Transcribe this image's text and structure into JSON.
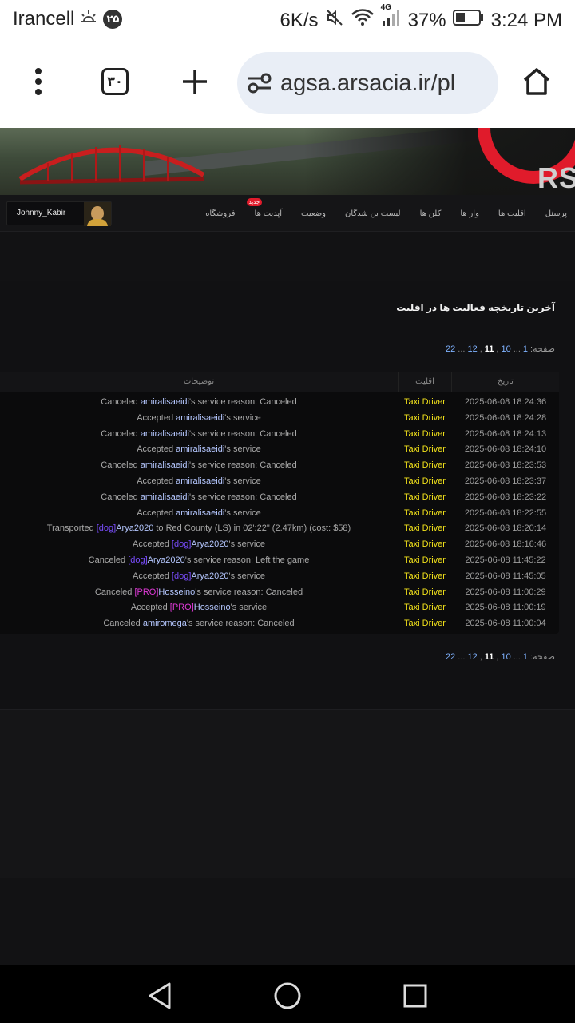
{
  "status_bar": {
    "carrier": "Irancell",
    "carrier_badge": "۲۵",
    "net_speed": "6K/s",
    "network_type": "4G",
    "battery": "37%",
    "time": "3:24 PM",
    "icons": [
      "sunset-icon",
      "mute-icon",
      "wifi-icon",
      "signal-icon",
      "battery-icon"
    ]
  },
  "browser": {
    "tab_count": "۳۰",
    "url": "agsa.arsacia.ir/pl",
    "icons": [
      "menu-dots-icon",
      "new-tab-icon",
      "site-settings-icon",
      "home-icon"
    ]
  },
  "site": {
    "logo_text": "RS",
    "nav_items": [
      {
        "label": "پرسنل"
      },
      {
        "label": "اقلیت ها"
      },
      {
        "label": "وار ها"
      },
      {
        "label": "کلن ها"
      },
      {
        "label": "لیست بن شدگان"
      },
      {
        "label": "وضعیت"
      },
      {
        "label": "آپدیت ها",
        "badge": "جدید"
      },
      {
        "label": "فروشگاه"
      }
    ],
    "user": {
      "name": "Johnny_Kabir"
    }
  },
  "history": {
    "heading": "آخرین تاریخچه فعالیت ها در اقلیت",
    "pagination": {
      "label": "صفحه:",
      "first": "1",
      "ellipsis": "...",
      "pages": [
        "10",
        "11",
        "12"
      ],
      "current": "11",
      "last": "22"
    },
    "columns": {
      "date": "تاریخ",
      "faction": "اقلیت",
      "description": "توضیحات"
    },
    "faction_color": "#f2e21b",
    "rows": [
      {
        "date": "2025-06-08 18:24:36",
        "faction": "Taxi Driver",
        "pre": "Canceled ",
        "tag": "",
        "name": "amiralisaeidi",
        "post": "'s service reason: Canceled"
      },
      {
        "date": "2025-06-08 18:24:28",
        "faction": "Taxi Driver",
        "pre": "Accepted ",
        "tag": "",
        "name": "amiralisaeidi",
        "post": "'s service"
      },
      {
        "date": "2025-06-08 18:24:13",
        "faction": "Taxi Driver",
        "pre": "Canceled ",
        "tag": "",
        "name": "amiralisaeidi",
        "post": "'s service reason: Canceled"
      },
      {
        "date": "2025-06-08 18:24:10",
        "faction": "Taxi Driver",
        "pre": "Accepted ",
        "tag": "",
        "name": "amiralisaeidi",
        "post": "'s service"
      },
      {
        "date": "2025-06-08 18:23:53",
        "faction": "Taxi Driver",
        "pre": "Canceled ",
        "tag": "",
        "name": "amiralisaeidi",
        "post": "'s service reason: Canceled"
      },
      {
        "date": "2025-06-08 18:23:37",
        "faction": "Taxi Driver",
        "pre": "Accepted ",
        "tag": "",
        "name": "amiralisaeidi",
        "post": "'s service"
      },
      {
        "date": "2025-06-08 18:23:22",
        "faction": "Taxi Driver",
        "pre": "Canceled ",
        "tag": "",
        "name": "amiralisaeidi",
        "post": "'s service reason: Canceled"
      },
      {
        "date": "2025-06-08 18:22:55",
        "faction": "Taxi Driver",
        "pre": "Accepted ",
        "tag": "",
        "name": "amiralisaeidi",
        "post": "'s service"
      },
      {
        "date": "2025-06-08 18:20:14",
        "faction": "Taxi Driver",
        "pre": "Transported ",
        "tag": "[dog]",
        "name": "Arya2020",
        "post": " to Red County (LS) in 02':22\" (2.47km) (cost: $58)"
      },
      {
        "date": "2025-06-08 18:16:46",
        "faction": "Taxi Driver",
        "pre": "Accepted ",
        "tag": "[dog]",
        "name": "Arya2020",
        "post": "'s service"
      },
      {
        "date": "2025-06-08 11:45:22",
        "faction": "Taxi Driver",
        "pre": "Canceled ",
        "tag": "[dog]",
        "name": "Arya2020",
        "post": "'s service reason: Left the game"
      },
      {
        "date": "2025-06-08 11:45:05",
        "faction": "Taxi Driver",
        "pre": "Accepted ",
        "tag": "[dog]",
        "name": "Arya2020",
        "post": "'s service"
      },
      {
        "date": "2025-06-08 11:00:29",
        "faction": "Taxi Driver",
        "pre": "Canceled ",
        "tag": "[PRO]",
        "name": "Hosseino",
        "post": "'s service reason: Canceled"
      },
      {
        "date": "2025-06-08 11:00:19",
        "faction": "Taxi Driver",
        "pre": "Accepted ",
        "tag": "[PRO]",
        "name": "Hosseino",
        "post": "'s service"
      },
      {
        "date": "2025-06-08 11:00:04",
        "faction": "Taxi Driver",
        "pre": "Canceled ",
        "tag": "",
        "name": "amiromega",
        "post": "'s service reason: Canceled"
      }
    ]
  },
  "android_nav": {
    "icons": [
      "back-icon",
      "home-circle-icon",
      "recents-icon"
    ]
  }
}
